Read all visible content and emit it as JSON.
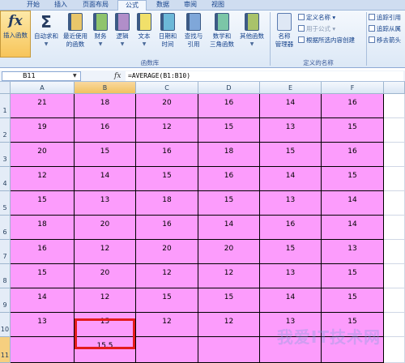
{
  "tabs": [
    {
      "label": "开始",
      "active": false
    },
    {
      "label": "插入",
      "active": false
    },
    {
      "label": "页面布局",
      "active": false
    },
    {
      "label": "公式",
      "active": true
    },
    {
      "label": "数据",
      "active": false
    },
    {
      "label": "审阅",
      "active": false
    },
    {
      "label": "视图",
      "active": false
    }
  ],
  "ribbon": {
    "insert_function": "插入函数",
    "autosum": "自动求和",
    "recent_1": "最近使用",
    "recent_2": "的函数",
    "financial": "财务",
    "logical": "逻辑",
    "text": "文本",
    "datetime_1": "日期和",
    "datetime_2": "时间",
    "lookup_1": "查找与",
    "lookup_2": "引用",
    "math_1": "数学和",
    "math_2": "三角函数",
    "more": "其他函数",
    "group_library": "函数库",
    "name_manager_1": "名称",
    "name_manager_2": "管理器",
    "define_name": "定义名称",
    "use_in_formula": "用于公式",
    "create_from_selection": "根据所选内容创建",
    "group_names": "定义的名称",
    "trace_precedents": "追踪引用",
    "trace_dependents": "追踪从属",
    "remove_arrows": "移去箭头"
  },
  "formula_bar": {
    "name_box": "B11",
    "fx_symbol": "fx",
    "formula": "=AVERAGE(B1:B10)"
  },
  "sheet": {
    "columns": [
      "A",
      "B",
      "C",
      "D",
      "E",
      "F"
    ],
    "rows": [
      "1",
      "2",
      "3",
      "4",
      "5",
      "6",
      "7",
      "8",
      "9",
      "10",
      "11"
    ],
    "cells": [
      [
        "21",
        "18",
        "20",
        "16",
        "14",
        "16"
      ],
      [
        "19",
        "16",
        "12",
        "15",
        "13",
        "15"
      ],
      [
        "20",
        "15",
        "16",
        "18",
        "15",
        "16"
      ],
      [
        "12",
        "14",
        "15",
        "16",
        "14",
        "15"
      ],
      [
        "15",
        "13",
        "18",
        "15",
        "13",
        "14"
      ],
      [
        "18",
        "20",
        "16",
        "14",
        "16",
        "14"
      ],
      [
        "16",
        "12",
        "20",
        "20",
        "15",
        "13"
      ],
      [
        "15",
        "20",
        "12",
        "12",
        "13",
        "15"
      ],
      [
        "14",
        "12",
        "15",
        "15",
        "14",
        "15"
      ],
      [
        "13",
        "15",
        "12",
        "12",
        "13",
        "15"
      ],
      [
        "",
        "15.5",
        "",
        "",
        "",
        ""
      ]
    ],
    "selected_cell": "B11"
  },
  "watermark": "我爱IT技术网",
  "colors": {
    "cell_fill": "#fc9cfc",
    "selection_outline": "#e31b1b"
  }
}
